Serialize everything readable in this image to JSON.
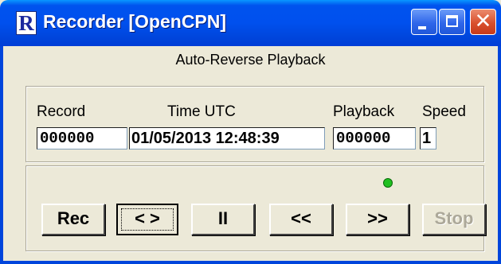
{
  "window": {
    "title": "Recorder [OpenCPN]",
    "icon_letter": "R",
    "mode_label": "Auto-Reverse Playback"
  },
  "colors": {
    "titlebar": "#0053ee",
    "close_button": "#d9502d",
    "led": "#20c020",
    "face": "#ece9d8"
  },
  "status": {
    "record_label": "Record",
    "record_value": "000000",
    "time_label": "Time UTC",
    "time_value": "01/05/2013 12:48:39",
    "playback_label": "Playback",
    "playback_value": "000000",
    "speed_label": "Speed",
    "speed_value": "1"
  },
  "controls": {
    "indicator": "green-led",
    "rec_label": "Rec",
    "reverse_label": "< >",
    "pause_label": "II",
    "rewind_label": "<<",
    "forward_label": ">>",
    "stop_label": "Stop"
  }
}
